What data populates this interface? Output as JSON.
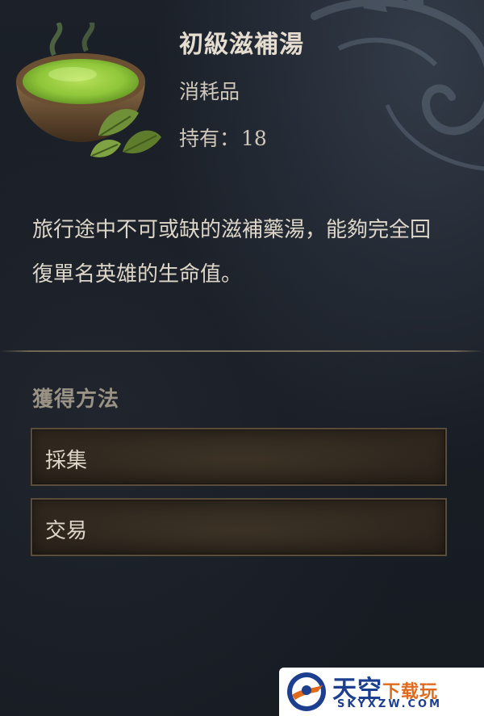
{
  "item": {
    "name": "初級滋補湯",
    "type": "消耗品",
    "count_label": "持有：",
    "count_value": "18",
    "icon": "herbal-soup-bowl-icon",
    "description": "旅行途中不可或缺的滋補藥湯，能夠完全回復單名英雄的生命值。"
  },
  "acquisition": {
    "title": "獲得方法",
    "methods": [
      {
        "label": "採集"
      },
      {
        "label": "交易"
      }
    ]
  },
  "watermark": {
    "title_main": "天空",
    "title_accent": "下载玩",
    "url": "SKYXZW.COM"
  },
  "colors": {
    "background": "#181c24",
    "button_border": "#5a4d39",
    "section_title": "#9a9285",
    "soup_green": "#8fc63a"
  }
}
